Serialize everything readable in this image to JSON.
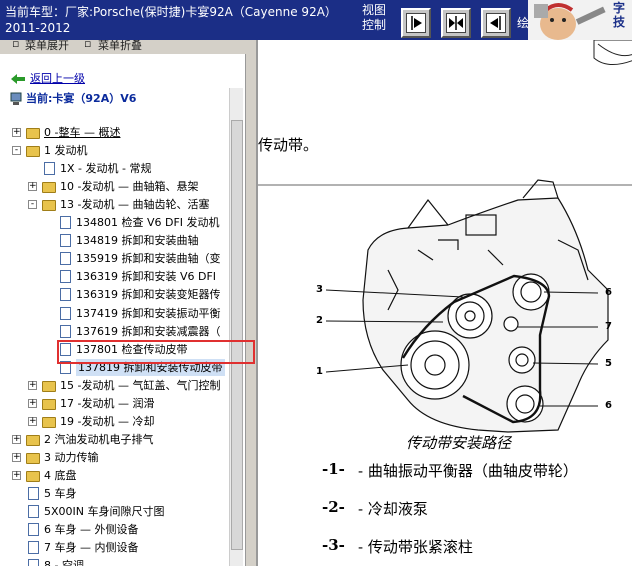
{
  "header": {
    "title_line1": "当前车型：厂家:Porsche(保时捷)卡宴92A（Cayenne 92A）",
    "title_line2": "2011-2012",
    "view_control": "视图控制",
    "nav_buttons": [
      "forward-arrow-icon",
      "expand-both-icon",
      "back-arrow-icon"
    ],
    "trailing_text": "绘",
    "logo_text": "字\n技"
  },
  "menu": {
    "expand_label": "菜单展开",
    "collapse_label": "菜单折叠"
  },
  "tree": {
    "back_label": "返回上一级",
    "current_label": "当前:卡宴（92A）V6",
    "items": [
      {
        "label": "0 -整车 — 概述",
        "level": 0,
        "type": "folder",
        "toggle": "+",
        "underline": true
      },
      {
        "label": "1 发动机",
        "level": 0,
        "type": "folder",
        "toggle": "-"
      },
      {
        "label": "1X - 发动机 - 常规",
        "level": 1,
        "type": "doc"
      },
      {
        "label": "10 -发动机 — 曲轴箱、悬架",
        "level": 1,
        "type": "folder",
        "toggle": "+"
      },
      {
        "label": "13 -发动机 — 曲轴齿轮、活塞",
        "level": 1,
        "type": "folder",
        "toggle": "-"
      },
      {
        "label": "134801 检查 V6 DFI 发动机",
        "level": 2,
        "type": "doc"
      },
      {
        "label": "134819 拆卸和安装曲轴",
        "level": 2,
        "type": "doc"
      },
      {
        "label": "135919 拆卸和安装曲轴（变",
        "level": 2,
        "type": "doc"
      },
      {
        "label": "136319 拆卸和安装 V6 DFI",
        "level": 2,
        "type": "doc"
      },
      {
        "label": "136319 拆卸和安装变矩器传",
        "level": 2,
        "type": "doc"
      },
      {
        "label": "137419 拆卸和安装振动平衡",
        "level": 2,
        "type": "doc"
      },
      {
        "label": "137619 拆卸和安装减震器（",
        "level": 2,
        "type": "doc"
      },
      {
        "label": "137801 检查传动皮带",
        "level": 2,
        "type": "doc"
      },
      {
        "label": "137819 拆卸和安装传动皮带",
        "level": 2,
        "type": "doc",
        "selected": true
      },
      {
        "label": "15 -发动机 — 气缸盖、气门控制",
        "level": 1,
        "type": "folder",
        "toggle": "+"
      },
      {
        "label": "17 -发动机 — 润滑",
        "level": 1,
        "type": "folder",
        "toggle": "+"
      },
      {
        "label": "19 -发动机 — 冷却",
        "level": 1,
        "type": "folder",
        "toggle": "+"
      },
      {
        "label": "2 汽油发动机电子排气",
        "level": 0,
        "type": "folder",
        "toggle": "+"
      },
      {
        "label": "3 动力传输",
        "level": 0,
        "type": "folder",
        "toggle": "+"
      },
      {
        "label": "4 底盘",
        "level": 0,
        "type": "folder",
        "toggle": "+"
      },
      {
        "label": "5 车身",
        "level": 0,
        "type": "doc"
      },
      {
        "label": "5X00IN 车身间隙尺寸图",
        "level": 0,
        "type": "doc"
      },
      {
        "label": "6 车身 — 外侧设备",
        "level": 0,
        "type": "doc"
      },
      {
        "label": "7 车身 — 内侧设备",
        "level": 0,
        "type": "doc"
      },
      {
        "label": "8 - 空调",
        "level": 0,
        "type": "doc"
      },
      {
        "label": "9 电气系统",
        "level": 0,
        "type": "doc"
      }
    ]
  },
  "content": {
    "heading_tail": "传动带。",
    "diagram_labels": [
      "3",
      "2",
      "1",
      "6",
      "7",
      "5",
      "6"
    ],
    "caption": "传动带安装路径",
    "legend": [
      {
        "num": "-1-",
        "text": "- 曲轴振动平衡器（曲轴皮带轮）"
      },
      {
        "num": "-2-",
        "text": "- 冷却液泵"
      },
      {
        "num": "-3-",
        "text": "- 传动带张紧滚柱"
      }
    ]
  }
}
